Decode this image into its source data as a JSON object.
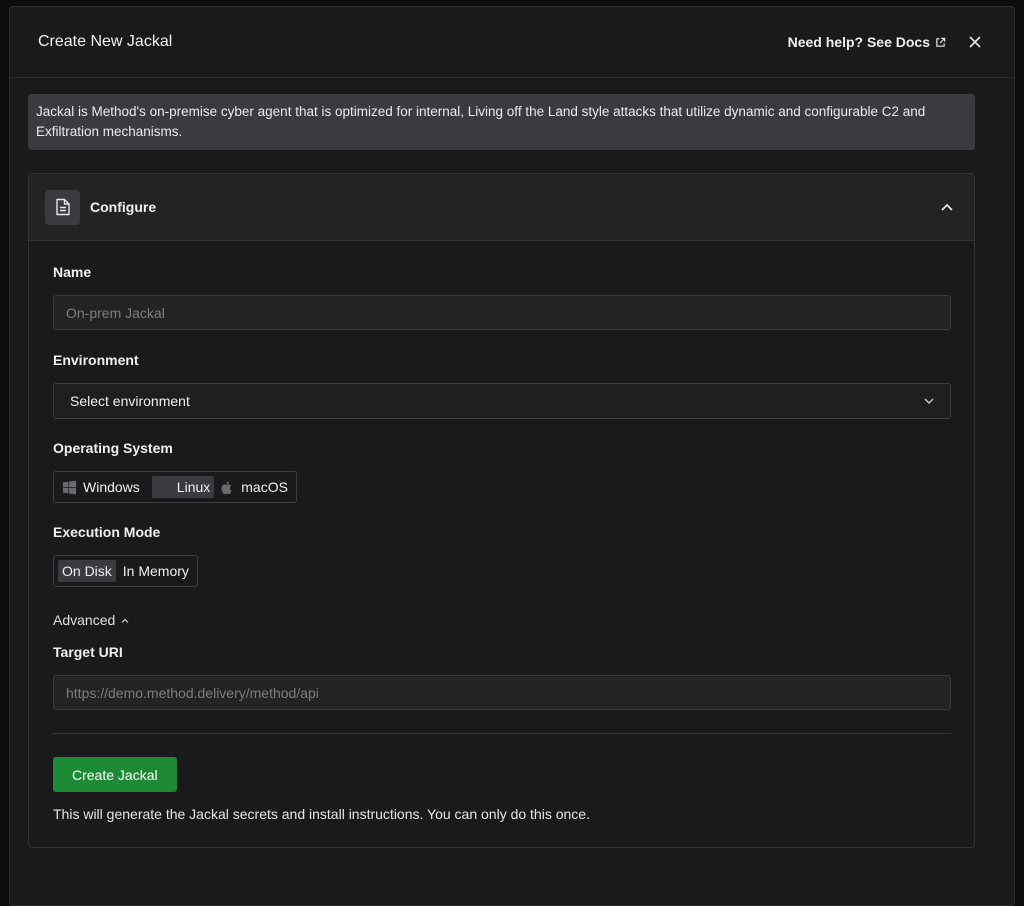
{
  "modal": {
    "title": "Create New Jackal",
    "help_link": "Need help? See Docs",
    "icons": {
      "external": "external-link-icon",
      "close": "close-icon"
    }
  },
  "info_banner": "Jackal is Method's on-premise cyber agent that is optimized for internal, Living off the Land style attacks that utilize dynamic and configurable C2 and Exfiltration mechanisms.",
  "configure": {
    "title": "Configure",
    "icon": "document-icon",
    "collapse_icon": "chevron-up-icon",
    "name": {
      "label": "Name",
      "placeholder": "On-prem Jackal",
      "value": ""
    },
    "environment": {
      "label": "Environment",
      "selected": "Select environment"
    },
    "os": {
      "label": "Operating System",
      "options": [
        "Windows",
        "Linux",
        "macOS"
      ],
      "selected": "Linux"
    },
    "execution_mode": {
      "label": "Execution Mode",
      "options": [
        "On Disk",
        "In Memory"
      ],
      "selected": "On Disk"
    },
    "advanced": {
      "label": "Advanced"
    },
    "target_uri": {
      "label": "Target URI",
      "placeholder": "https://demo.method.delivery/method/api",
      "value": ""
    },
    "submit_label": "Create Jackal",
    "footnote": "This will generate the Jackal secrets and install instructions. You can only do this once."
  },
  "colors": {
    "accent": "#1d8a35",
    "surface": "#1a1a1c",
    "banner": "#3a3a40"
  }
}
